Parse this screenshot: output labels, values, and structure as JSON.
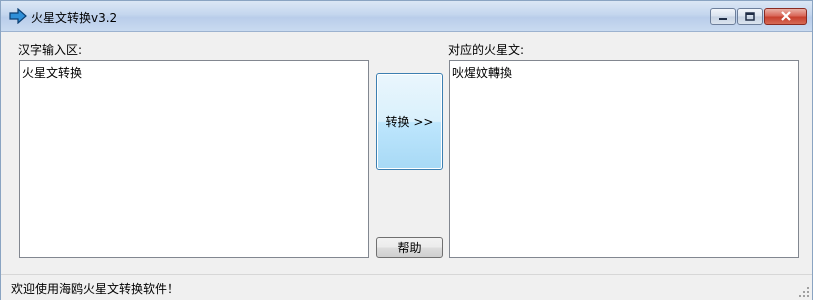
{
  "window": {
    "title": "火星文转换v3.2"
  },
  "input_panel": {
    "label": "汉字输入区:",
    "value": "火星文转换"
  },
  "output_panel": {
    "label": "对应的火星文:",
    "value": "吙煋妏轉換"
  },
  "buttons": {
    "convert_label": "转换 >>",
    "help_label": "帮助"
  },
  "statusbar": {
    "text": "欢迎使用海鸥火星文转换软件！"
  },
  "icons": {
    "app": "arrow-right-icon",
    "minimize": "minimize-icon",
    "maximize": "maximize-icon",
    "close": "close-icon",
    "grip": "resize-grip-icon"
  },
  "colors": {
    "convert_button_border": "#3c7fb1",
    "close_button": "#c7402f"
  }
}
